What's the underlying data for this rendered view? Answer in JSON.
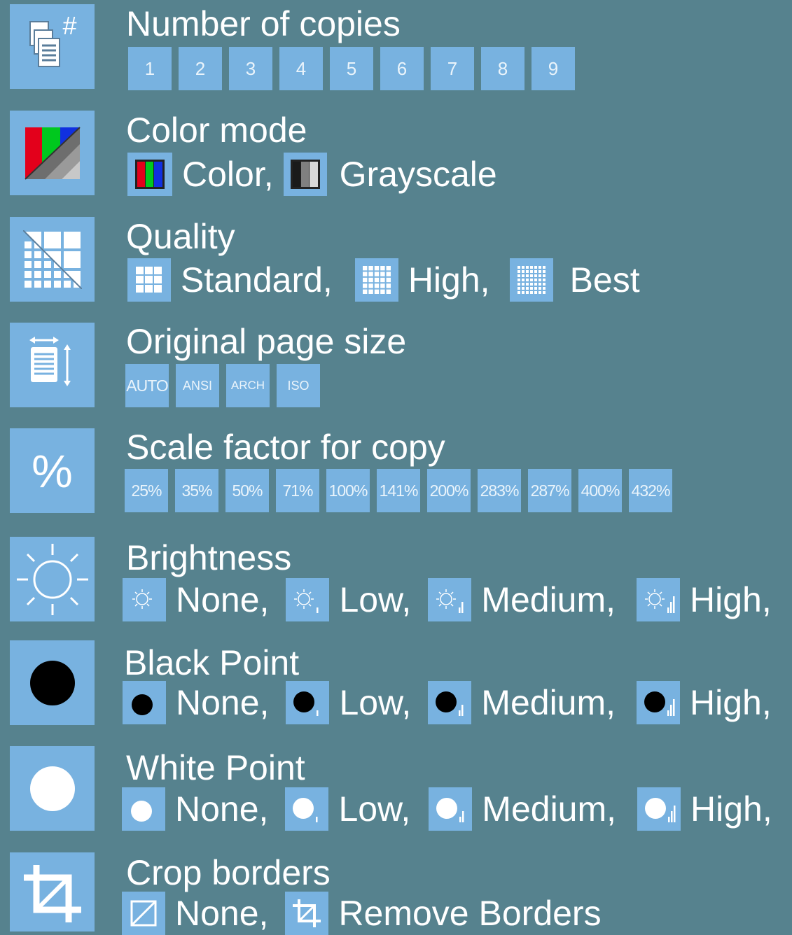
{
  "copies": {
    "title": "Number of copies",
    "icon": "copies-hash-icon",
    "options": [
      "1",
      "2",
      "3",
      "4",
      "5",
      "6",
      "7",
      "8",
      "9"
    ]
  },
  "color_mode": {
    "title": "Color mode",
    "icon": "color-mode-icon",
    "options": [
      {
        "label": "Color,",
        "icon": "color-bars-icon"
      },
      {
        "label": "Grayscale",
        "icon": "grayscale-bars-icon"
      }
    ]
  },
  "quality": {
    "title": "Quality",
    "icon": "quality-grid-icon",
    "options": [
      {
        "label": "Standard,",
        "icon": "grid-coarse-icon"
      },
      {
        "label": "High,",
        "icon": "grid-medium-icon"
      },
      {
        "label": "Best",
        "icon": "grid-fine-icon"
      }
    ]
  },
  "page_size": {
    "title": "Original page size",
    "icon": "page-size-icon",
    "options": [
      "AUTO",
      "ANSI",
      "ARCH",
      "ISO"
    ]
  },
  "scale": {
    "title": "Scale factor for copy",
    "icon_text": "%",
    "icon": "percent-icon",
    "options": [
      "25%",
      "35%",
      "50%",
      "71%",
      "100%",
      "141%",
      "200%",
      "283%",
      "287%",
      "400%",
      "432%"
    ]
  },
  "brightness": {
    "title": "Brightness",
    "icon": "sun-icon",
    "options": [
      {
        "label": "None,",
        "icon": "sun-level-0-icon"
      },
      {
        "label": "Low,",
        "icon": "sun-level-1-icon"
      },
      {
        "label": "Medium,",
        "icon": "sun-level-2-icon"
      },
      {
        "label": "High,",
        "icon": "sun-level-3-icon"
      }
    ]
  },
  "black_point": {
    "title": "Black Point",
    "icon": "black-dot-icon",
    "options": [
      {
        "label": "None,",
        "icon": "black-dot-level-0-icon"
      },
      {
        "label": "Low,",
        "icon": "black-dot-level-1-icon"
      },
      {
        "label": "Medium,",
        "icon": "black-dot-level-2-icon"
      },
      {
        "label": "High,",
        "icon": "black-dot-level-3-icon"
      }
    ]
  },
  "white_point": {
    "title": "White Point",
    "icon": "white-dot-icon",
    "options": [
      {
        "label": "None,",
        "icon": "white-dot-level-0-icon"
      },
      {
        "label": "Low,",
        "icon": "white-dot-level-1-icon"
      },
      {
        "label": "Medium,",
        "icon": "white-dot-level-2-icon"
      },
      {
        "label": "High,",
        "icon": "white-dot-level-3-icon"
      }
    ]
  },
  "crop": {
    "title": "Crop borders",
    "icon": "crop-icon",
    "options": [
      {
        "label": "None,",
        "icon": "crop-none-icon"
      },
      {
        "label": "Remove Borders",
        "icon": "crop-remove-icon"
      }
    ]
  },
  "colors": {
    "background": "#56828e",
    "tile": "#78b2e0",
    "text": "#ffffff"
  }
}
